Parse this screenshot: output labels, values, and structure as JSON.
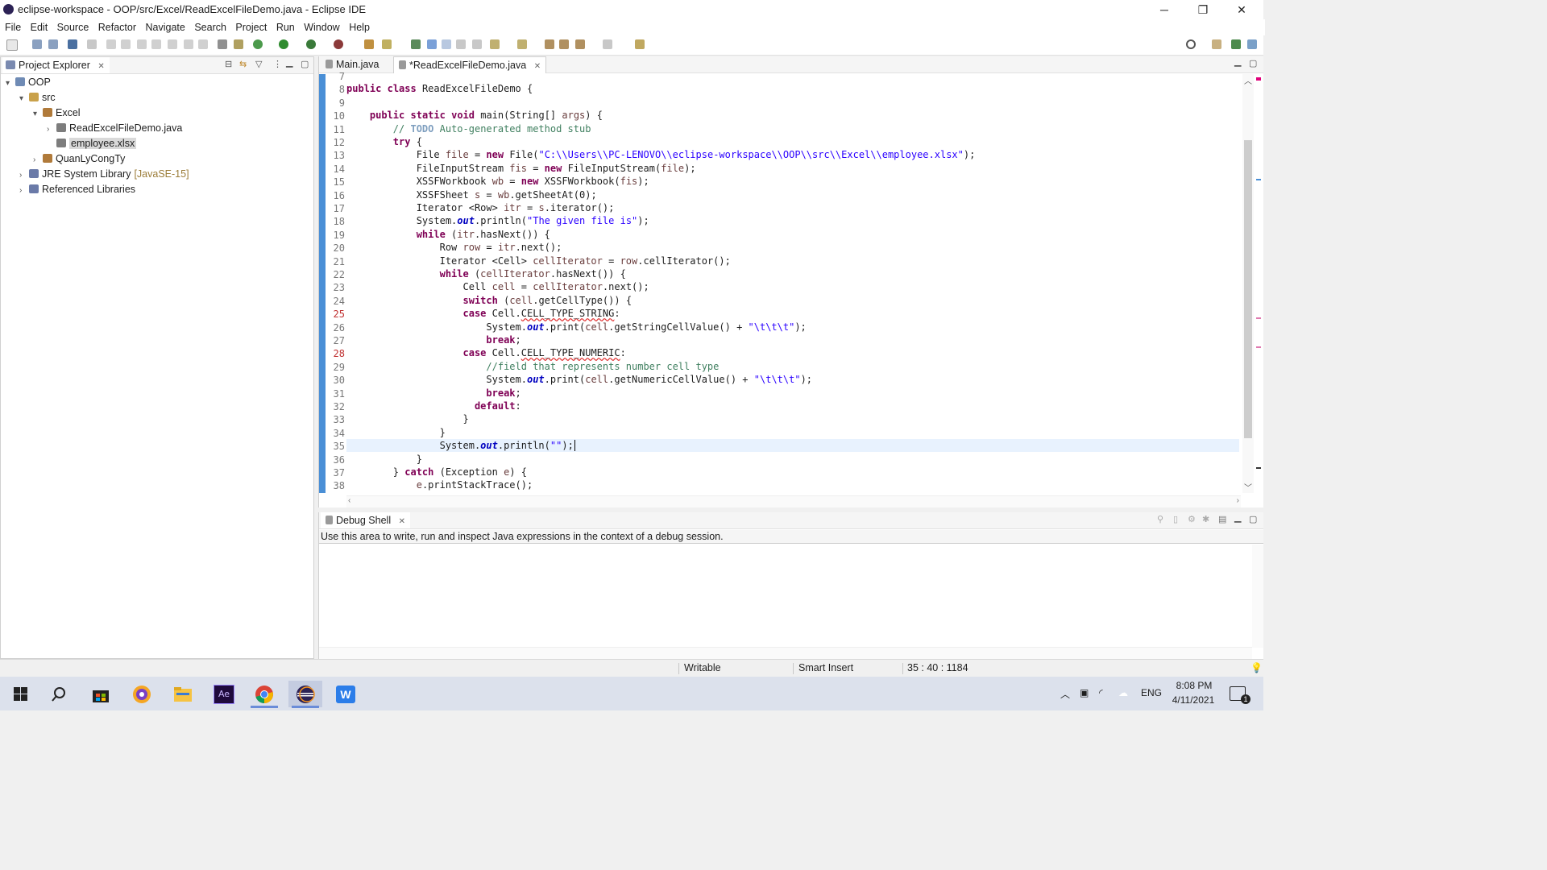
{
  "window": {
    "title": "eclipse-workspace - OOP/src/Excel/ReadExcelFileDemo.java - Eclipse IDE",
    "minimize": "─",
    "maximize": "❐",
    "close": "✕"
  },
  "menu": [
    "File",
    "Edit",
    "Source",
    "Refactor",
    "Navigate",
    "Search",
    "Project",
    "Run",
    "Window",
    "Help"
  ],
  "explorer": {
    "title": "Project Explorer",
    "tree": [
      {
        "label": "OOP",
        "depth": 0,
        "twisty": "▾",
        "icon": "project-icon",
        "color": "#6f8bb5"
      },
      {
        "label": "src",
        "depth": 1,
        "twisty": "▾",
        "icon": "source-folder-icon",
        "color": "#c9a14a"
      },
      {
        "label": "Excel",
        "depth": 2,
        "twisty": "▾",
        "icon": "package-icon",
        "color": "#b07a3a"
      },
      {
        "label": "ReadExcelFileDemo.java",
        "depth": 3,
        "twisty": "›",
        "icon": "java-file-icon",
        "color": "#7d7d7d"
      },
      {
        "label": "employee.xlsx",
        "depth": 3,
        "twisty": "",
        "icon": "file-icon",
        "color": "#7d7d7d",
        "selected": true
      },
      {
        "label": "QuanLyCongTy",
        "depth": 2,
        "twisty": "›",
        "icon": "package-icon",
        "color": "#b07a3a"
      },
      {
        "label": "JRE System Library",
        "suffix": "[JavaSE-15]",
        "depth": 1,
        "twisty": "›",
        "icon": "library-icon",
        "color": "#6a7aa8"
      },
      {
        "label": "Referenced Libraries",
        "depth": 1,
        "twisty": "›",
        "icon": "library-icon",
        "color": "#6a7aa8"
      }
    ]
  },
  "editor": {
    "tabs": [
      {
        "label": "Main.java",
        "active": false
      },
      {
        "label": "*ReadExcelFileDemo.java",
        "active": true
      }
    ],
    "first_line": 7,
    "current_line": 35
  },
  "debug": {
    "title": "Debug Shell",
    "description": "Use this area to write, run and inspect Java expressions in the context of a debug session."
  },
  "status": {
    "mode": "Writable",
    "insert": "Smart Insert",
    "position": "35 : 40 : 1184"
  },
  "taskbar": {
    "time": "8:08 PM",
    "date": "4/11/2021",
    "lang": "ENG",
    "notif_count": "1",
    "apps": [
      "start-button",
      "search-icon",
      "store-icon",
      "browser-icon",
      "file-explorer-icon",
      "after-effects-icon",
      "chrome-icon",
      "eclipse-icon",
      "writer-icon"
    ]
  },
  "colors": {
    "keyword": "#7f0055",
    "string": "#2a00ff",
    "comment": "#3f7f5f",
    "field": "#0000c0",
    "ruler": "#4a8fd6"
  }
}
